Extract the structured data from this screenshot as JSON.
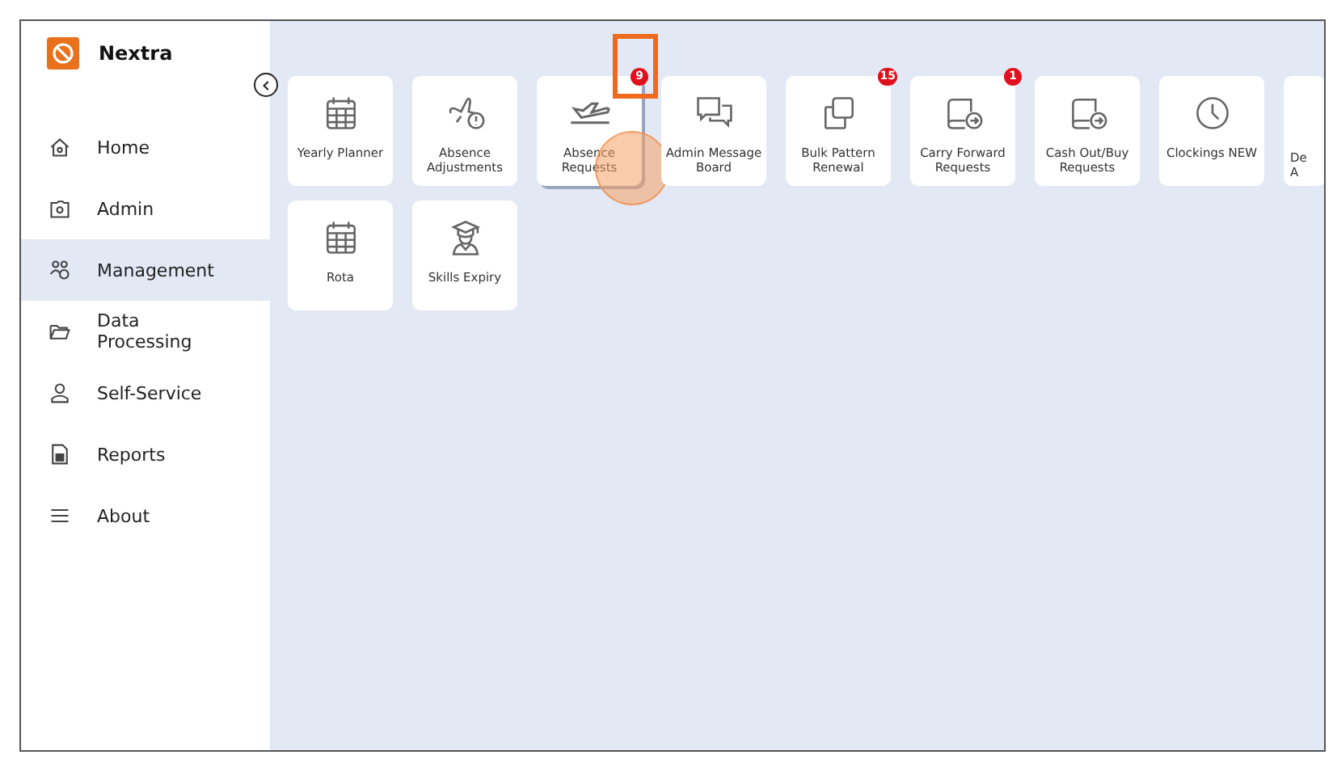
{
  "brand": {
    "name": "Nextra"
  },
  "sidebar": {
    "items": [
      {
        "label": "Home",
        "selected": false
      },
      {
        "label": "Admin",
        "selected": false
      },
      {
        "label": "Management",
        "selected": true
      },
      {
        "label": "Data Processing",
        "selected": false
      },
      {
        "label": "Self-Service",
        "selected": false
      },
      {
        "label": "Reports",
        "selected": false
      },
      {
        "label": "About",
        "selected": false
      }
    ]
  },
  "tiles": [
    {
      "label": "Yearly Planner",
      "pressed": false
    },
    {
      "label": "Absence Adjustments",
      "pressed": false
    },
    {
      "label": "Absence Requests",
      "badge": "9",
      "pressed": true,
      "highlighted": true
    },
    {
      "label": "Admin Message Board",
      "pressed": false
    },
    {
      "label": "Bulk Pattern Renewal",
      "badge": "15",
      "pressed": false
    },
    {
      "label": "Carry Forward Requests",
      "badge": "1",
      "pressed": false
    },
    {
      "label": "Cash Out/Buy Requests",
      "pressed": false
    },
    {
      "label": "Clockings NEW",
      "pressed": false
    },
    {
      "label": "De A",
      "pressed": false
    },
    {
      "label": "Rota",
      "pressed": false
    },
    {
      "label": "Skills Expiry",
      "pressed": false
    }
  ]
}
